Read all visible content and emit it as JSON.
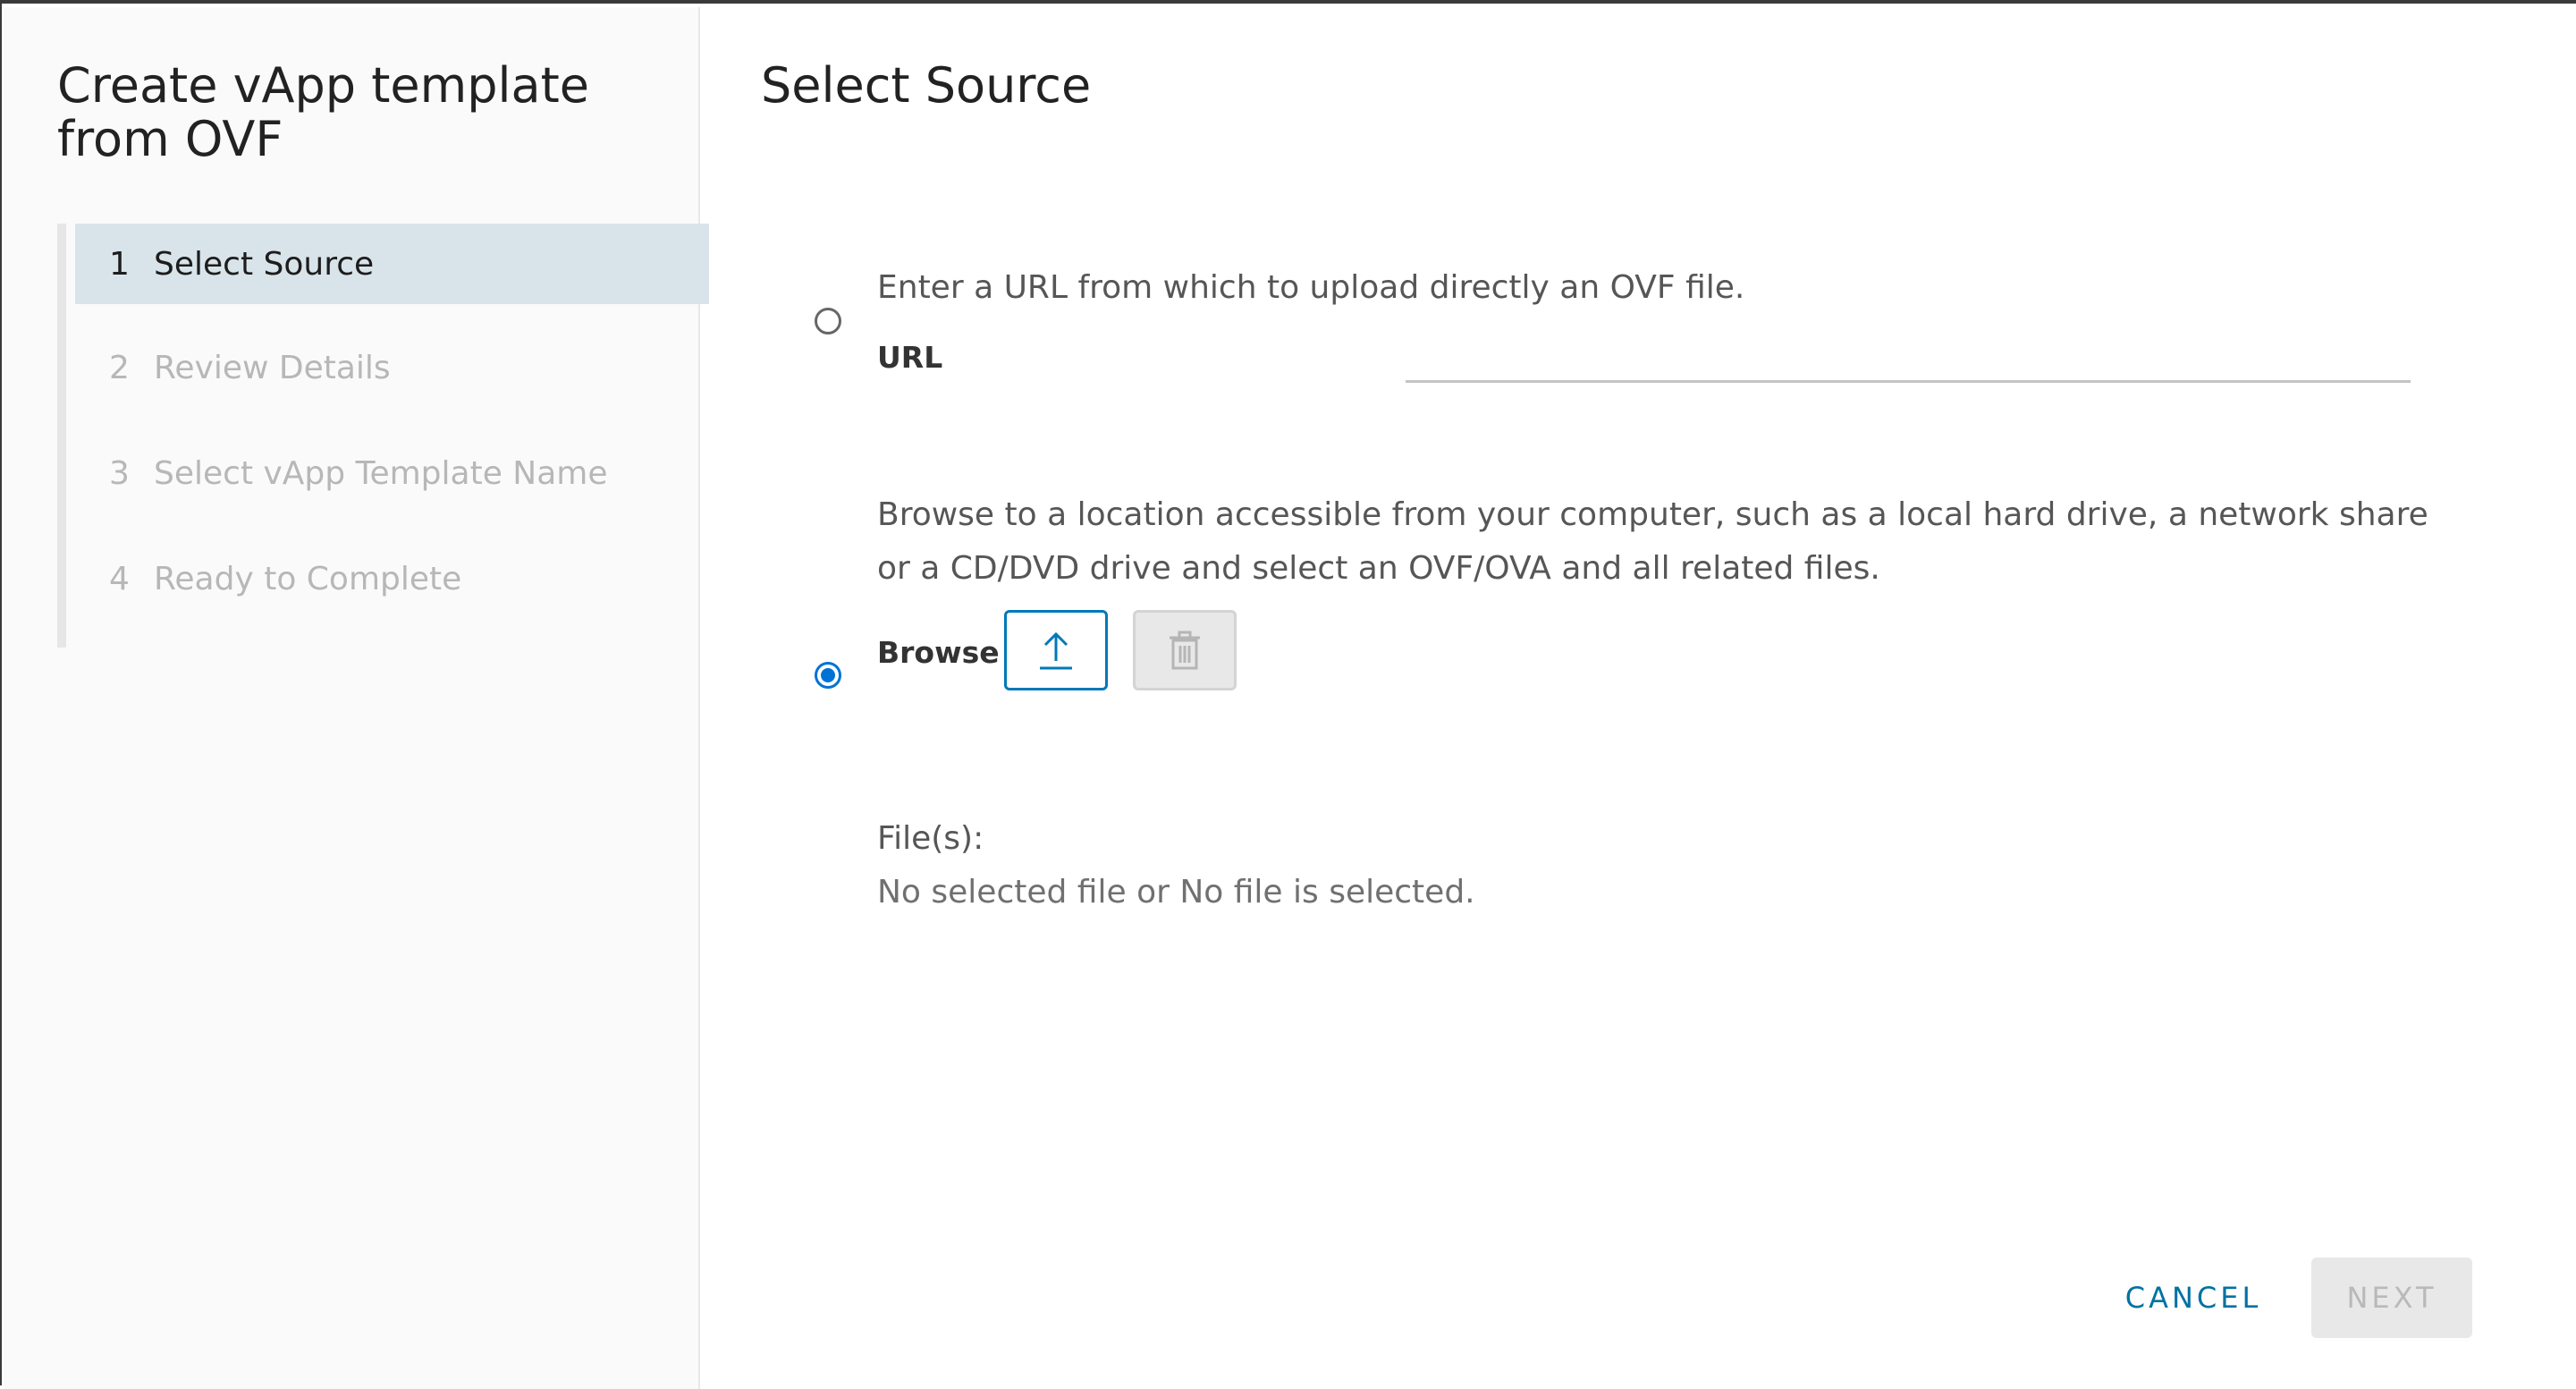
{
  "wizard": {
    "title": "Create vApp template from OVF",
    "steps": [
      {
        "num": "1",
        "label": "Select Source",
        "active": true
      },
      {
        "num": "2",
        "label": "Review Details",
        "active": false
      },
      {
        "num": "3",
        "label": "Select vApp Template Name",
        "active": false
      },
      {
        "num": "4",
        "label": "Ready to Complete",
        "active": false
      }
    ]
  },
  "page": {
    "title": "Select Source",
    "url_option": {
      "description": "Enter a URL from which to upload directly an OVF file.",
      "label": "URL",
      "value": "",
      "selected": false
    },
    "browse_option": {
      "description": "Browse to a location accessible from your computer, such as a local hard drive, a network share or a CD/DVD drive and select an OVF/OVA and all related files.",
      "label": "Browse",
      "selected": true,
      "upload_icon": "upload-icon",
      "delete_icon": "trash-icon"
    },
    "files": {
      "label": "File(s):",
      "value": "No selected file or No file is selected."
    }
  },
  "footer": {
    "cancel_label": "CANCEL",
    "next_label": "NEXT"
  },
  "colors": {
    "accent": "#0072d6",
    "link": "#0072a3",
    "active_step_bg": "#d9e4ea",
    "disabled_bg": "#e8e8e8"
  }
}
